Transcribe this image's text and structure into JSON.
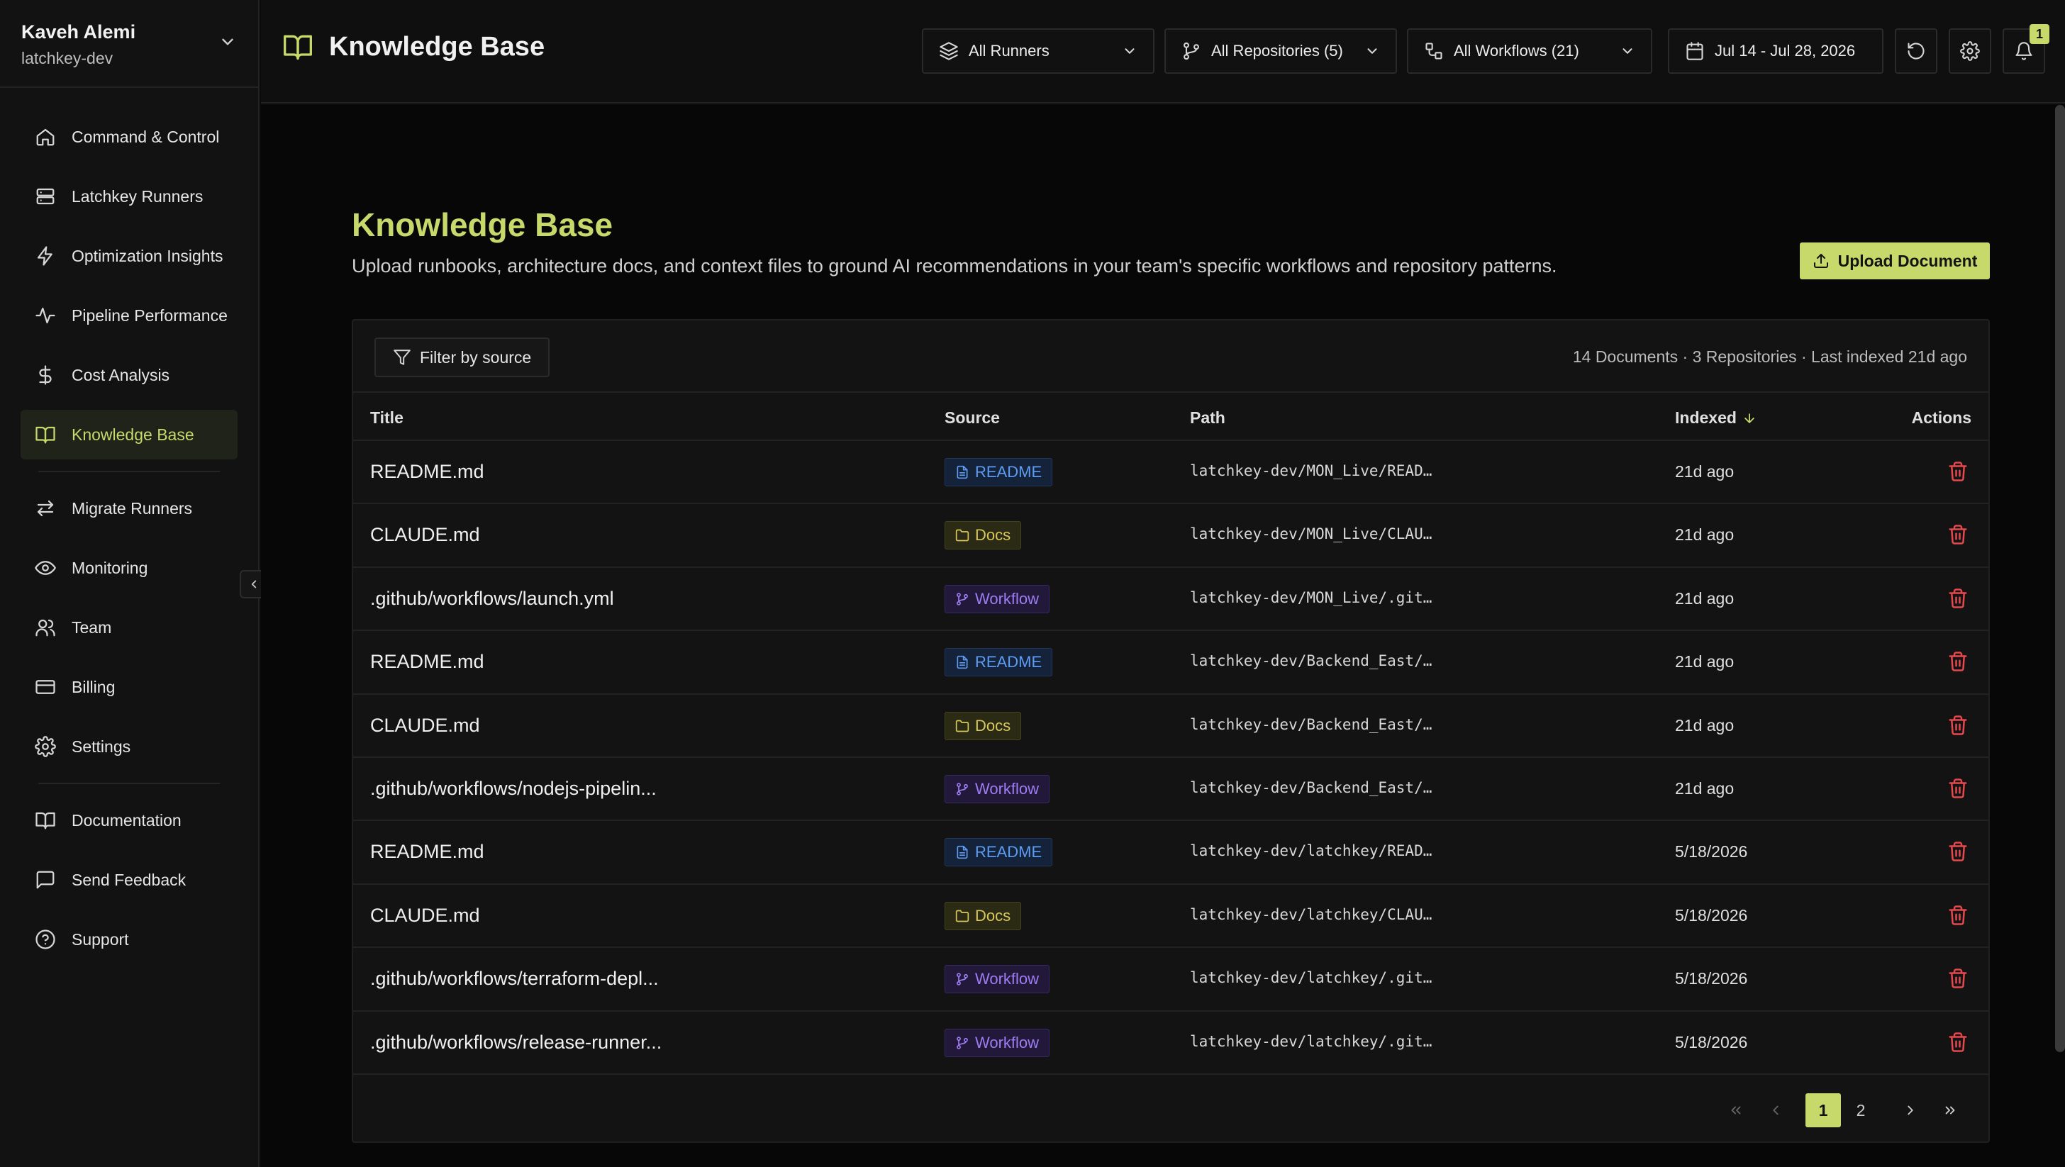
{
  "profile": {
    "name": "Kaveh Alemi",
    "org": "latchkey-dev"
  },
  "nav": {
    "primary": [
      {
        "label": "Command & Control",
        "icon": "home-icon"
      },
      {
        "label": "Latchkey Runners",
        "icon": "server-icon"
      },
      {
        "label": "Optimization Insights",
        "icon": "lightning-icon"
      },
      {
        "label": "Pipeline Performance",
        "icon": "activity-icon"
      },
      {
        "label": "Cost Analysis",
        "icon": "dollar-icon"
      },
      {
        "label": "Knowledge Base",
        "icon": "book-icon",
        "active": true
      }
    ],
    "secondary": [
      {
        "label": "Migrate Runners",
        "icon": "swap-icon"
      },
      {
        "label": "Monitoring",
        "icon": "eye-icon"
      },
      {
        "label": "Team",
        "icon": "users-icon"
      },
      {
        "label": "Billing",
        "icon": "credit-card-icon"
      },
      {
        "label": "Settings",
        "icon": "gear-icon"
      }
    ],
    "footer": [
      {
        "label": "Documentation",
        "icon": "book-icon"
      },
      {
        "label": "Send Feedback",
        "icon": "message-icon"
      },
      {
        "label": "Support",
        "icon": "help-icon"
      }
    ]
  },
  "header": {
    "title": "Knowledge Base",
    "runners": "All Runners",
    "repositories": "All Repositories (5)",
    "workflows": "All Workflows (21)",
    "date_range": "Jul 14 - Jul 28, 2026",
    "notifications_count": "1"
  },
  "page": {
    "title": "Knowledge Base",
    "description": "Upload runbooks, architecture docs, and context files to ground AI recommendations in your team's specific workflows and repository patterns.",
    "upload_label": "Upload Document",
    "filter_label": "Filter by source",
    "stats": "14 Documents · 3 Repositories · Last indexed 21d ago"
  },
  "table": {
    "columns": {
      "title": "Title",
      "source": "Source",
      "path": "Path",
      "indexed": "Indexed",
      "actions": "Actions"
    },
    "rows": [
      {
        "title": "README.md",
        "source": "README",
        "path": "latchkey-dev/MON_Live/READ…",
        "indexed": "21d ago"
      },
      {
        "title": "CLAUDE.md",
        "source": "Docs",
        "path": "latchkey-dev/MON_Live/CLAU…",
        "indexed": "21d ago"
      },
      {
        "title": ".github/workflows/launch.yml",
        "source": "Workflow",
        "path": "latchkey-dev/MON_Live/.git…",
        "indexed": "21d ago"
      },
      {
        "title": "README.md",
        "source": "README",
        "path": "latchkey-dev/Backend_East/…",
        "indexed": "21d ago"
      },
      {
        "title": "CLAUDE.md",
        "source": "Docs",
        "path": "latchkey-dev/Backend_East/…",
        "indexed": "21d ago"
      },
      {
        "title": ".github/workflows/nodejs-pipelin...",
        "source": "Workflow",
        "path": "latchkey-dev/Backend_East/…",
        "indexed": "21d ago"
      },
      {
        "title": "README.md",
        "source": "README",
        "path": "latchkey-dev/latchkey/READ…",
        "indexed": "5/18/2026"
      },
      {
        "title": "CLAUDE.md",
        "source": "Docs",
        "path": "latchkey-dev/latchkey/CLAU…",
        "indexed": "5/18/2026"
      },
      {
        "title": ".github/workflows/terraform-depl...",
        "source": "Workflow",
        "path": "latchkey-dev/latchkey/.git…",
        "indexed": "5/18/2026"
      },
      {
        "title": ".github/workflows/release-runner...",
        "source": "Workflow",
        "path": "latchkey-dev/latchkey/.git…",
        "indexed": "5/18/2026"
      }
    ]
  },
  "pagination": {
    "pages": [
      "1",
      "2"
    ],
    "current": "1"
  },
  "colors": {
    "accent": "#c6d96a",
    "readme": "#5d9cf2",
    "docs": "#d8c75a",
    "workflow": "#9e7cf2",
    "danger": "#e5484d"
  }
}
